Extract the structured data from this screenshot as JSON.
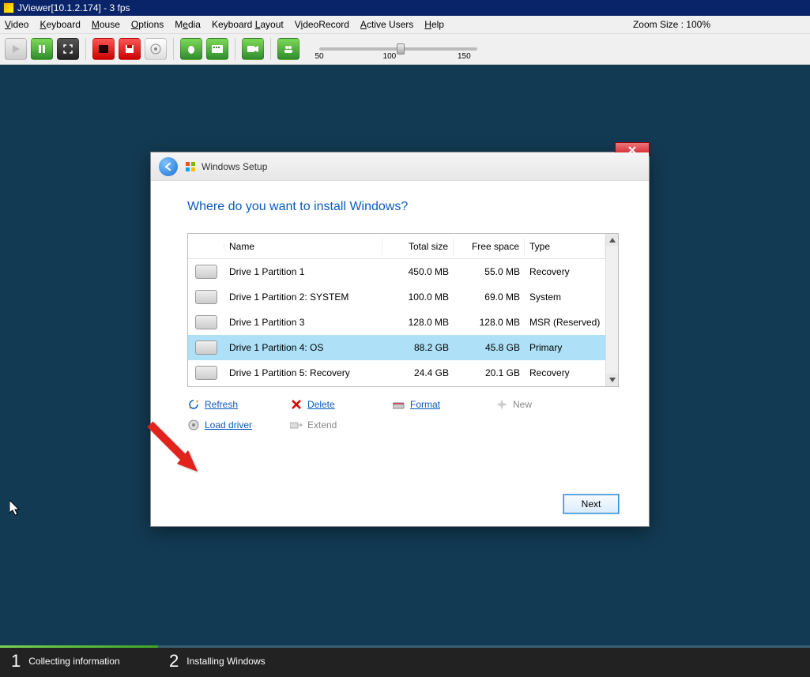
{
  "jviewer": {
    "title": "JViewer[10.1.2.174] - 3 fps",
    "menu": {
      "video": "Video",
      "keyboard": "Keyboard",
      "mouse": "Mouse",
      "options": "Options",
      "media": "Media",
      "kblayout": "Keyboard Layout",
      "videorecord": "VideoRecord",
      "activeusers": "Active Users",
      "help": "Help"
    },
    "zoom_label": "Zoom Size : 100%",
    "slider": {
      "min": "50",
      "mid": "100",
      "max": "150"
    }
  },
  "dialog": {
    "title": "Windows Setup",
    "heading": "Where do you want to install Windows?",
    "columns": {
      "name": "Name",
      "total": "Total size",
      "free": "Free space",
      "type": "Type"
    },
    "rows": [
      {
        "name": "Drive 1 Partition 1",
        "total": "450.0 MB",
        "free": "55.0 MB",
        "type": "Recovery",
        "selected": false
      },
      {
        "name": "Drive 1 Partition 2: SYSTEM",
        "total": "100.0 MB",
        "free": "69.0 MB",
        "type": "System",
        "selected": false
      },
      {
        "name": "Drive 1 Partition 3",
        "total": "128.0 MB",
        "free": "128.0 MB",
        "type": "MSR (Reserved)",
        "selected": false
      },
      {
        "name": "Drive 1 Partition 4: OS",
        "total": "88.2 GB",
        "free": "45.8 GB",
        "type": "Primary",
        "selected": true
      },
      {
        "name": "Drive 1 Partition 5: Recovery",
        "total": "24.4 GB",
        "free": "20.1 GB",
        "type": "Recovery",
        "selected": false
      }
    ],
    "tools": {
      "refresh": "Refresh",
      "delete": "Delete",
      "format": "Format",
      "new": "New",
      "loaddriver": "Load driver",
      "extend": "Extend"
    },
    "next": "Next"
  },
  "progress": {
    "step1_num": "1",
    "step1_label": "Collecting information",
    "step2_num": "2",
    "step2_label": "Installing Windows"
  }
}
